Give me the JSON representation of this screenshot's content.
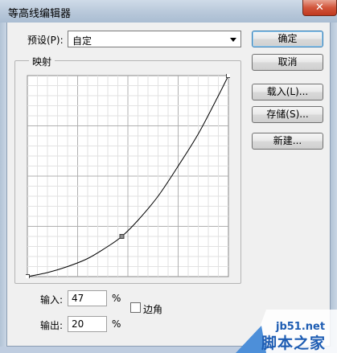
{
  "window": {
    "title": "等高线编辑器",
    "close_glyph": "✕"
  },
  "preset": {
    "label": "预设(P):",
    "value": "自定"
  },
  "mapping": {
    "group_label": "映射"
  },
  "buttons": {
    "ok": "确定",
    "cancel": "取消",
    "load": "载入(L)...",
    "save": "存储(S)...",
    "new": "新建..."
  },
  "input": {
    "label": "输入:",
    "value": "47",
    "unit": "%"
  },
  "output": {
    "label": "输出:",
    "value": "20",
    "unit": "%"
  },
  "corner": {
    "label": "边角",
    "checked": false
  },
  "watermark": {
    "url": "jb51.net",
    "text": "脚本之家"
  },
  "chart_data": {
    "type": "line",
    "x": [
      0,
      10,
      20,
      30,
      40,
      47,
      55,
      65,
      75,
      85,
      95,
      100
    ],
    "y": [
      0,
      2,
      5,
      9,
      15,
      20,
      28,
      40,
      55,
      71,
      90,
      100
    ],
    "selected_point": {
      "x": 47,
      "y": 20
    },
    "control_points": [
      {
        "x": 0,
        "y": 0
      },
      {
        "x": 47,
        "y": 20
      },
      {
        "x": 100,
        "y": 100
      }
    ],
    "xlim": [
      0,
      100
    ],
    "ylim": [
      0,
      100
    ],
    "grid": true,
    "title": "",
    "xlabel": "",
    "ylabel": ""
  }
}
